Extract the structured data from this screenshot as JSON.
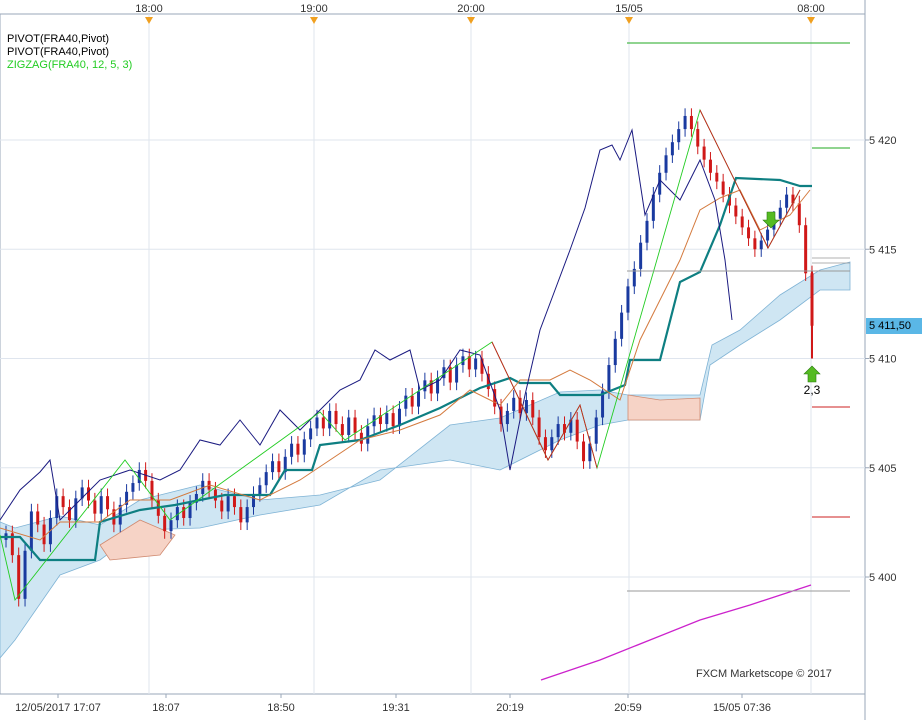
{
  "legend": [
    {
      "label": "PIVOT(FRA40,Pivot)",
      "color": "#000000"
    },
    {
      "label": "PIVOT(FRA40,Pivot)",
      "color": "#000000"
    },
    {
      "label": "ZIGZAG(FRA40, 12, 5, 3)",
      "color": "#22cc22"
    }
  ],
  "credit": "FXCM Marketscope © 2017",
  "current_price_label": "5 411,50",
  "annotation_label": "2,3",
  "chart_data": {
    "type": "candlestick",
    "title": "",
    "instrument": "FRA40",
    "xlabel": "",
    "ylabel": "",
    "ylim": [
      5395.5,
      5426.5
    ],
    "grid": true,
    "top_time_labels": [
      "18:00",
      "19:00",
      "20:00",
      "15/05",
      "08:00"
    ],
    "bottom_time_labels": [
      "12/05/2017 17:07",
      "18:07",
      "18:50",
      "19:31",
      "20:19",
      "20:59",
      "15/05 07:36"
    ],
    "y_ticks": [
      {
        "value": 5400,
        "label": "5 400"
      },
      {
        "value": 5405,
        "label": "5 405"
      },
      {
        "value": 5410,
        "label": "5 410"
      },
      {
        "value": 5415,
        "label": "5 415"
      },
      {
        "value": 5420,
        "label": "5 420"
      }
    ],
    "current_price": 5411.5,
    "indicators": [
      "Ichimoku cloud",
      "Tenkan-sen",
      "Kijun-sen",
      "Chikou span",
      "ZigZag",
      "Pivot levels",
      "Moving average"
    ],
    "close": [
      5402.0,
      5401.0,
      5399.0,
      5401.2,
      5403.0,
      5402.4,
      5401.5,
      5402.7,
      5403.7,
      5403.2,
      5402.6,
      5403.6,
      5404.1,
      5403.5,
      5402.9,
      5403.7,
      5403.1,
      5402.4,
      5403.3,
      5403.9,
      5404.3,
      5404.9,
      5404.4,
      5403.5,
      5402.8,
      5402.1,
      5402.6,
      5403.2,
      5402.7,
      5403.4,
      5403.8,
      5404.4,
      5404.0,
      5403.5,
      5403.0,
      5403.7,
      5403.2,
      5402.5,
      5403.2,
      5403.8,
      5404.2,
      5404.8,
      5405.3,
      5404.8,
      5405.5,
      5406.1,
      5405.6,
      5406.3,
      5406.8,
      5407.3,
      5406.8,
      5407.6,
      5407.0,
      5406.5,
      5407.3,
      5406.6,
      5406.1,
      5406.9,
      5407.4,
      5407.0,
      5407.5,
      5406.9,
      5407.7,
      5408.3,
      5407.8,
      5408.5,
      5409.0,
      5408.4,
      5409.1,
      5409.6,
      5408.9,
      5409.7,
      5410.1,
      5409.5,
      5410.0,
      5409.3,
      5408.6,
      5407.8,
      5407.0,
      5407.6,
      5408.2,
      5407.5,
      5408.1,
      5407.3,
      5406.4,
      5405.8,
      5406.4,
      5407.0,
      5406.6,
      5407.2,
      5406.2,
      5405.3,
      5406.1,
      5407.3,
      5408.5,
      5409.7,
      5410.9,
      5412.1,
      5413.3,
      5414.1,
      5415.3,
      5416.3,
      5417.5,
      5418.5,
      5419.3,
      5419.9,
      5420.5,
      5421.1,
      5420.5,
      5419.7,
      5419.1,
      5418.5,
      5418.1,
      5417.5,
      5417.0,
      5416.5,
      5416.0,
      5415.5,
      5415.0,
      5415.4,
      5415.9,
      5416.4,
      5416.9,
      5417.5,
      5417.1,
      5416.1,
      5413.9,
      5411.5
    ]
  }
}
